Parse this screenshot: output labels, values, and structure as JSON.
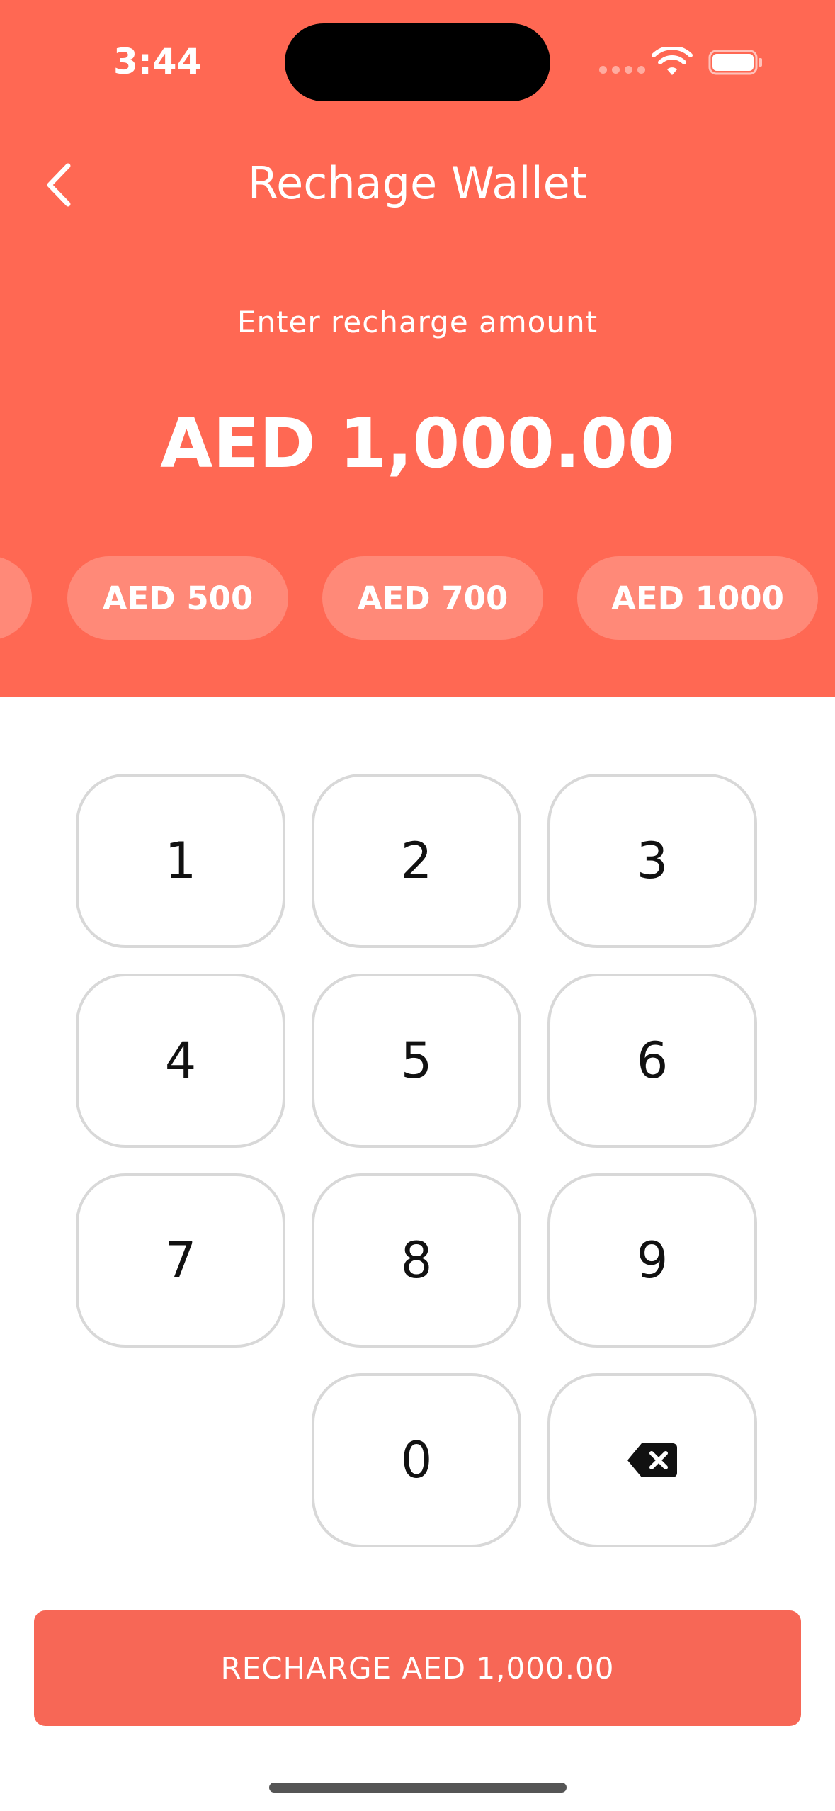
{
  "status_bar": {
    "time": "3:44"
  },
  "header": {
    "title": "Rechage Wallet",
    "subtitle": "Enter recharge amount",
    "amount": "AED 1,000.00",
    "background_color": "#FF6853"
  },
  "presets": [
    {
      "label": ""
    },
    {
      "label": "AED 500"
    },
    {
      "label": "AED 700"
    },
    {
      "label": "AED 1000"
    }
  ],
  "keypad": {
    "keys": [
      "1",
      "2",
      "3",
      "4",
      "5",
      "6",
      "7",
      "8",
      "9",
      "0"
    ],
    "backspace_icon": "backspace-icon"
  },
  "cta": {
    "label": "RECHARGE AED 1,000.00",
    "color": "#F76756"
  }
}
